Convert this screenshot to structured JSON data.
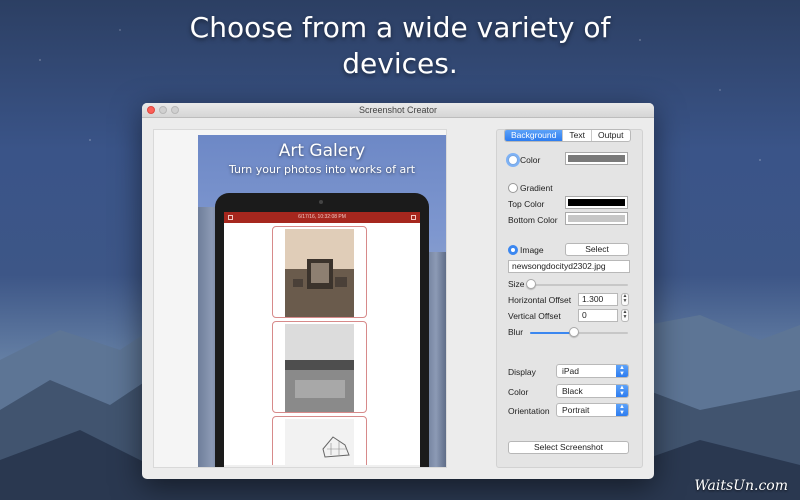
{
  "headline": {
    "line1": "Choose from a wide variety of",
    "line2": "devices."
  },
  "window": {
    "title": "Screenshot Creator"
  },
  "preview": {
    "title": "Art Galery",
    "subtitle": "Turn your photos into works of art",
    "status_bar": "6/17/16, 10:32:08 PM"
  },
  "tabs": [
    {
      "label": "Background",
      "active": true
    },
    {
      "label": "Text",
      "active": false
    },
    {
      "label": "Output",
      "active": false
    }
  ],
  "background": {
    "color_label": "Color",
    "color_value": "#7a7a7a",
    "gradient_label": "Gradient",
    "top_color_label": "Top Color",
    "top_color_value": "#000000",
    "bottom_color_label": "Bottom Color",
    "bottom_color_value": "#c6c6c6",
    "image_label": "Image",
    "select_label": "Select",
    "image_file": "newsongdocityd2302.jpg",
    "size_label": "Size",
    "size_value": 0.0,
    "h_offset_label": "Horizontal Offset",
    "h_offset_value": "1.300",
    "v_offset_label": "Vertical Offset",
    "v_offset_value": "0",
    "blur_label": "Blur",
    "blur_value": 0.5
  },
  "device": {
    "display_label": "Display",
    "display_value": "iPad",
    "color_label": "Color",
    "color_value": "Black",
    "orientation_label": "Orientation",
    "orientation_value": "Portrait"
  },
  "select_screenshot_label": "Select Screenshot",
  "watermark": "WaitsUn.com"
}
